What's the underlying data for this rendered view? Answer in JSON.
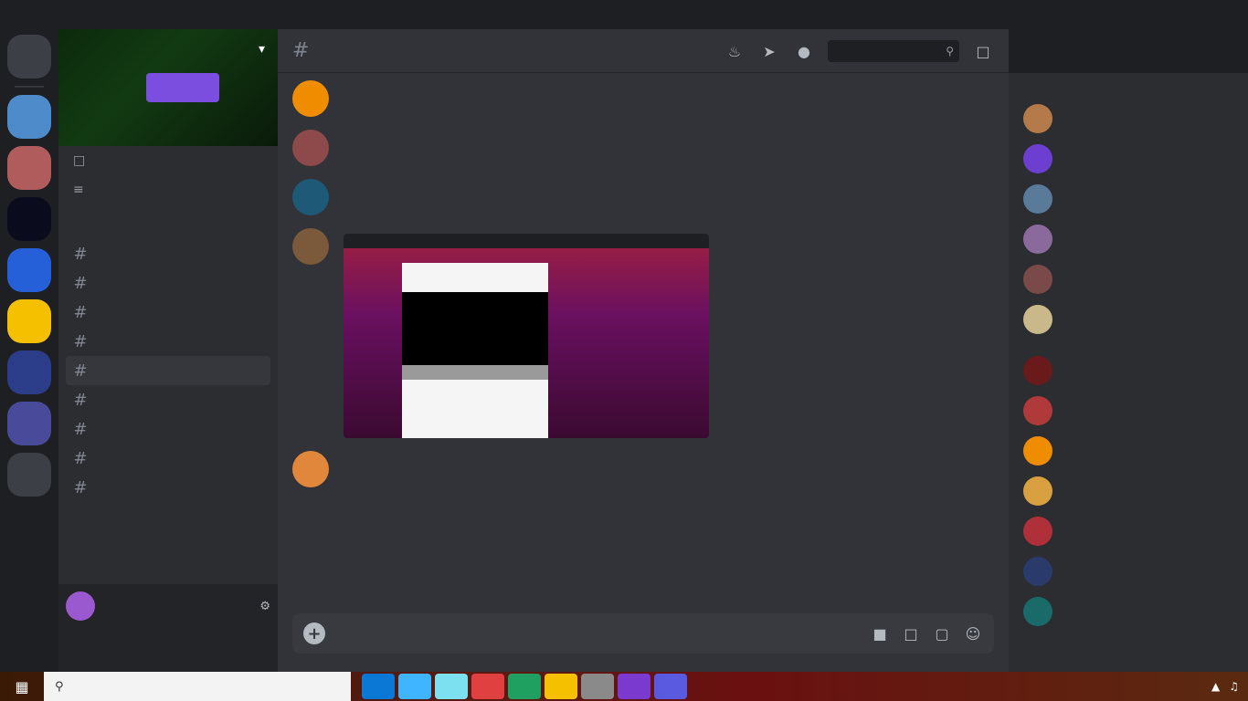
{
  "server": {
    "name": "",
    "icons": [
      {
        "label": "",
        "color": "#3c3f45"
      },
      {
        "label": "",
        "color": "#4e8bcb"
      },
      {
        "label": "",
        "color": "#b05c5c"
      },
      {
        "label": "",
        "color": "#f0b24a"
      },
      {
        "label": "",
        "color": "#0b0b1e"
      },
      {
        "label": "",
        "color": "#2560d8"
      },
      {
        "label": "",
        "color": "#4a5a8a"
      },
      {
        "label": "",
        "color": "#f5c000"
      },
      {
        "label": "",
        "color": "#1b2a5a"
      },
      {
        "label": "",
        "color": "#2c3e8a"
      },
      {
        "label": "",
        "color": "#4a4a9a"
      },
      {
        "label": "",
        "color": "#3c3f45"
      }
    ]
  },
  "sidebar": {
    "lines": [
      {
        "label": ""
      },
      {
        "label": ""
      }
    ],
    "category": "",
    "channels": [
      {
        "label": ""
      },
      {
        "label": ""
      },
      {
        "label": ""
      },
      {
        "label": ""
      },
      {
        "label": "",
        "active": true
      },
      {
        "label": ""
      },
      {
        "label": ""
      },
      {
        "label": ""
      },
      {
        "label": ""
      }
    ],
    "user": {
      "name": "",
      "status": ""
    }
  },
  "chat": {
    "channel_name": "",
    "search_placeholder": "",
    "messages": [
      {
        "author": "",
        "author_color": "#f8a13c",
        "time": "",
        "text": "",
        "avatar_color": "#f08c00"
      },
      {
        "author": "",
        "author_color": "#e03b3b",
        "time": "",
        "text": "",
        "avatar_color": "#8e4a4a"
      },
      {
        "author": "",
        "author_color": "#3fb4ff",
        "time": "",
        "text": "",
        "avatar_color": "#1e5a78"
      },
      {
        "author": "",
        "author_color": "#23c96e",
        "time": "",
        "text": "",
        "avatar_color": "#7a5a3a",
        "has_attachment": true
      },
      {
        "author": "",
        "author_color": "#e03b3b",
        "time": "",
        "text": "",
        "avatar_color": "#e0873c"
      }
    ],
    "composer_placeholder": ""
  },
  "members": {
    "groups": [
      {
        "title": "",
        "members": [
          {
            "name": "",
            "color": "#b47a4a"
          },
          {
            "name": "",
            "color": "#6c3fd0"
          },
          {
            "name": "",
            "color": "#5a7a9a"
          },
          {
            "name": "",
            "color": "#8a6a9a"
          },
          {
            "name": "",
            "color": "#7a4a4a"
          },
          {
            "name": "",
            "color": "#c8b88a"
          }
        ]
      },
      {
        "title": "",
        "members": [
          {
            "name": "",
            "color": "#6a1a1a"
          },
          {
            "name": "",
            "color": "#b03a3a"
          },
          {
            "name": "",
            "color": "#f08c00"
          },
          {
            "name": "",
            "color": "#d8a040"
          },
          {
            "name": "",
            "color": "#b0303a"
          },
          {
            "name": "",
            "color": "#2a3a6a"
          },
          {
            "name": "",
            "color": "#1a6a6a"
          }
        ]
      }
    ]
  },
  "taskbar": {
    "search_placeholder": "",
    "apps": [
      {
        "name": "",
        "color": "#0a78d4"
      },
      {
        "name": "",
        "color": "#3fb4ff"
      },
      {
        "name": "",
        "color": "#7de0f0"
      },
      {
        "name": "",
        "color": "#e04040"
      },
      {
        "name": "",
        "color": "#20a060"
      },
      {
        "name": "",
        "color": "#f5c000"
      },
      {
        "name": "",
        "color": "#8a8a8a"
      },
      {
        "name": "",
        "color": "#7a3ad0"
      },
      {
        "name": "",
        "color": "#5a5ae0"
      }
    ]
  }
}
